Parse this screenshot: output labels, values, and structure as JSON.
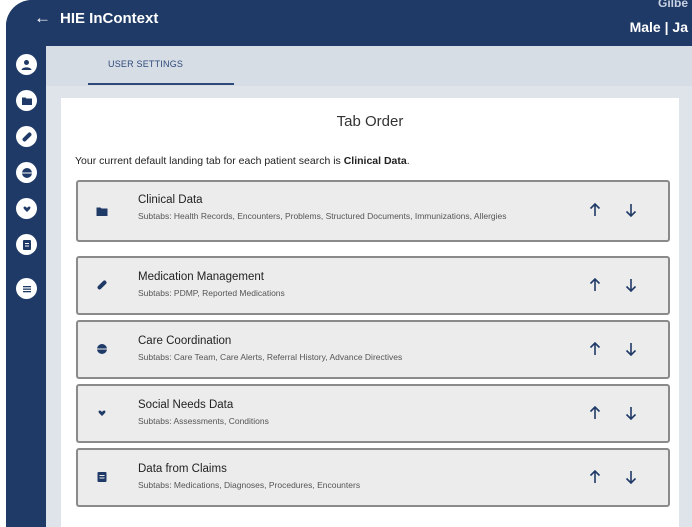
{
  "header": {
    "back_glyph": "←",
    "app_title": "HIE InContext",
    "patient_name_partial": "Gilbe",
    "patient_meta_partial": "Male | Ja"
  },
  "colors": {
    "brand_navy": "#1f3a66",
    "tab_text": "#2e4a7a",
    "content_bg": "#dfe4ea",
    "row_bg": "#ececec",
    "row_border": "#8a8a8a"
  },
  "rail": {
    "icons": [
      "user-icon",
      "folder-icon",
      "pill-icon",
      "globe-icon",
      "heart-hands-icon",
      "document-icon",
      "list-icon"
    ]
  },
  "tabs": {
    "active": "USER SETTINGS"
  },
  "page": {
    "title": "Tab Order",
    "intro_prefix": "Your current default landing tab for each patient search is ",
    "intro_bold": "Clinical Data",
    "intro_suffix": "."
  },
  "rows": [
    {
      "icon": "folder-icon",
      "title": "Clinical Data",
      "subtitle": "Subtabs: Health Records, Encounters, Problems, Structured Documents, Immunizations, Allergies"
    },
    {
      "icon": "pill-icon",
      "title": "Medication Management",
      "subtitle": "Subtabs: PDMP, Reported Medications"
    },
    {
      "icon": "globe-icon",
      "title": "Care Coordination",
      "subtitle": "Subtabs: Care Team, Care Alerts, Referral History, Advance Directives"
    },
    {
      "icon": "heart-hands-icon",
      "title": "Social Needs Data",
      "subtitle": "Subtabs: Assessments, Conditions"
    },
    {
      "icon": "document-icon",
      "title": "Data from Claims",
      "subtitle": "Subtabs: Medications, Diagnoses, Procedures, Encounters"
    }
  ],
  "arrows": {
    "up": "↑",
    "down": "↓"
  }
}
